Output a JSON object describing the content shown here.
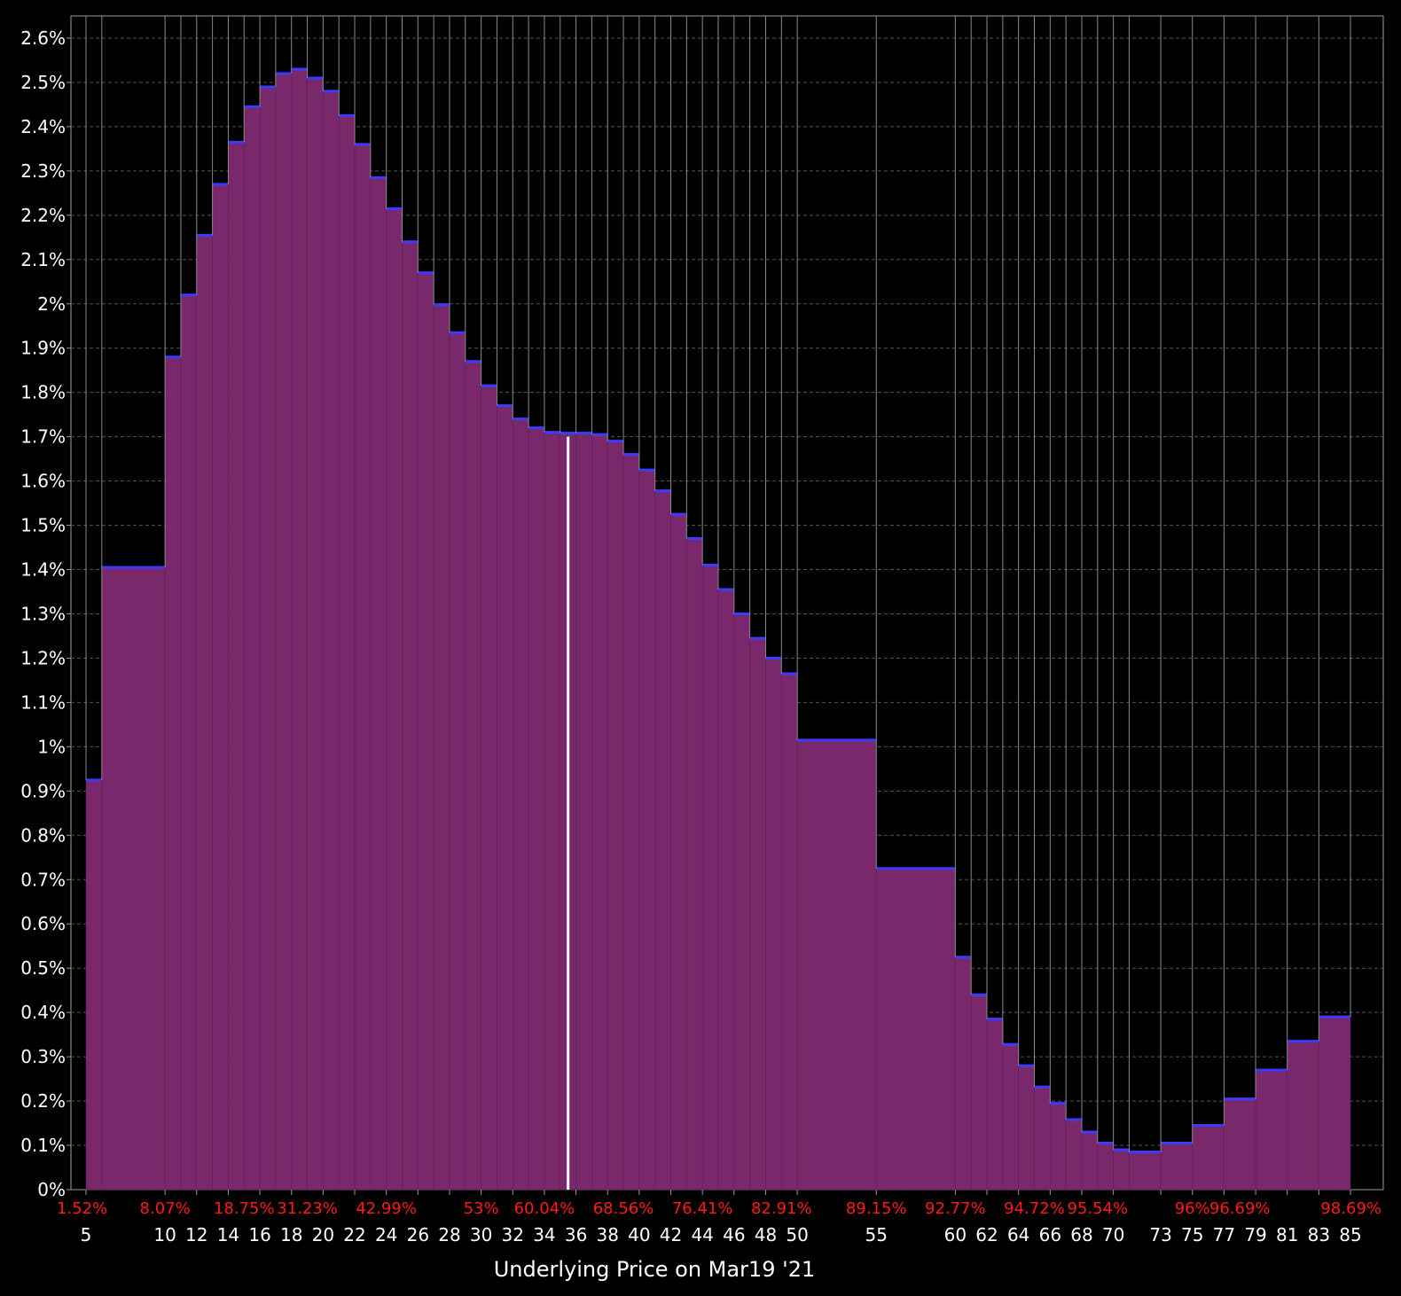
{
  "chart_data": {
    "type": "bar",
    "xlabel": "Underlying Price on Mar19 '21",
    "ylabel": "",
    "ylim": [
      0,
      2.6
    ],
    "y_ticks": [
      "0%",
      "0.1%",
      "0.2%",
      "0.3%",
      "0.4%",
      "0.5%",
      "0.6%",
      "0.7%",
      "0.8%",
      "0.9%",
      "1%",
      "1.1%",
      "1.2%",
      "1.3%",
      "1.4%",
      "1.5%",
      "1.6%",
      "1.7%",
      "1.8%",
      "1.9%",
      "2%",
      "2.1%",
      "2.2%",
      "2.3%",
      "2.4%",
      "2.5%",
      "2.6%"
    ],
    "grid": true,
    "x_ticks": [
      "5",
      "10",
      "12",
      "14",
      "16",
      "18",
      "20",
      "22",
      "24",
      "26",
      "28",
      "30",
      "32",
      "34",
      "36",
      "38",
      "40",
      "42",
      "44",
      "46",
      "48",
      "50",
      "55",
      "60",
      "62",
      "64",
      "66",
      "68",
      "70",
      "73",
      "75",
      "77",
      "79",
      "81",
      "83",
      "85"
    ],
    "strikes": [
      5,
      6,
      10,
      11,
      12,
      13,
      14,
      15,
      16,
      17,
      18,
      19,
      20,
      21,
      22,
      23,
      24,
      25,
      26,
      27,
      28,
      29,
      30,
      31,
      32,
      33,
      34,
      35,
      36,
      37,
      38,
      39,
      40,
      41,
      42,
      43,
      44,
      45,
      46,
      47,
      48,
      49,
      50,
      55,
      60,
      61,
      62,
      63,
      64,
      65,
      66,
      67,
      68,
      69,
      70,
      71,
      73,
      75,
      77,
      79,
      81,
      83,
      85
    ],
    "values": [
      0.925,
      1.405,
      1.88,
      2.02,
      2.155,
      2.27,
      2.365,
      2.445,
      2.49,
      2.52,
      2.53,
      2.51,
      2.48,
      2.425,
      2.36,
      2.285,
      2.215,
      2.14,
      2.07,
      1.998,
      1.935,
      1.87,
      1.815,
      1.77,
      1.74,
      1.72,
      1.71,
      1.708,
      1.708,
      1.705,
      1.69,
      1.66,
      1.625,
      1.578,
      1.525,
      1.47,
      1.41,
      1.355,
      1.3,
      1.245,
      1.2,
      1.165,
      1.015,
      0.725,
      0.525,
      0.44,
      0.385,
      0.328,
      0.28,
      0.232,
      0.195,
      0.158,
      0.13,
      0.105,
      0.09,
      0.085,
      0.105,
      0.145,
      0.205,
      0.27,
      0.335,
      0.39
    ],
    "cumulative_labels": [
      {
        "strike": 5,
        "label": "1.52%"
      },
      {
        "strike": 10,
        "label": "8.07%"
      },
      {
        "strike": 15,
        "label": "18.75%"
      },
      {
        "strike": 19,
        "label": "31.23%"
      },
      {
        "strike": 24,
        "label": "42.99%"
      },
      {
        "strike": 30,
        "label": "53%"
      },
      {
        "strike": 34,
        "label": "60.04%"
      },
      {
        "strike": 39,
        "label": "68.56%"
      },
      {
        "strike": 44,
        "label": "76.41%"
      },
      {
        "strike": 49,
        "label": "82.91%"
      },
      {
        "strike": 55,
        "label": "89.15%"
      },
      {
        "strike": 60,
        "label": "92.77%"
      },
      {
        "strike": 65,
        "label": "94.72%"
      },
      {
        "strike": 69,
        "label": "95.54%"
      },
      {
        "strike": 75,
        "label": "96%"
      },
      {
        "strike": 78,
        "label": "96.69%"
      },
      {
        "strike": 84,
        "label": "98.69%"
      }
    ],
    "current_price": 35.5,
    "current_price_level": 1.7,
    "colors": {
      "background": "#000000",
      "fill": "#7a286c",
      "cap": "#3b3bff",
      "grid": "#555555",
      "percent_labels": "#ff1a1a",
      "marker": "#ffffff"
    }
  }
}
